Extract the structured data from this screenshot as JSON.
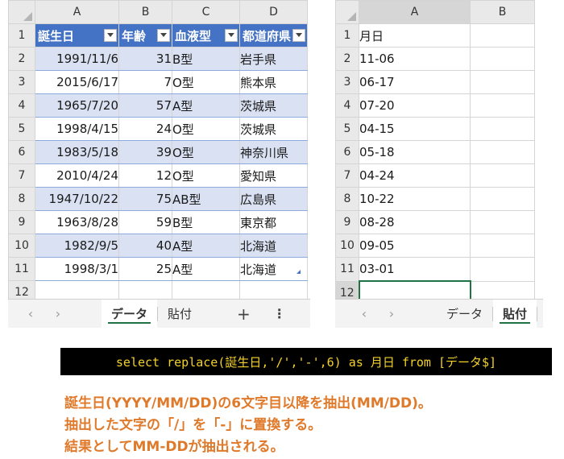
{
  "left_sheet": {
    "columns": [
      "A",
      "B",
      "C",
      "D"
    ],
    "header": [
      "誕生日",
      "年齢",
      "血液型",
      "都道府県"
    ],
    "rows": [
      {
        "n": "2",
        "date": "1991/11/6",
        "age": "31",
        "blood": "B型",
        "pref": "岩手県"
      },
      {
        "n": "3",
        "date": "2015/6/17",
        "age": "7",
        "blood": "O型",
        "pref": "熊本県"
      },
      {
        "n": "4",
        "date": "1965/7/20",
        "age": "57",
        "blood": "A型",
        "pref": "茨城県"
      },
      {
        "n": "5",
        "date": "1998/4/15",
        "age": "24",
        "blood": "O型",
        "pref": "茨城県"
      },
      {
        "n": "6",
        "date": "1983/5/18",
        "age": "39",
        "blood": "O型",
        "pref": "神奈川県"
      },
      {
        "n": "7",
        "date": "2010/4/24",
        "age": "12",
        "blood": "O型",
        "pref": "愛知県"
      },
      {
        "n": "8",
        "date": "1947/10/22",
        "age": "75",
        "blood": "AB型",
        "pref": "広島県"
      },
      {
        "n": "9",
        "date": "1963/8/28",
        "age": "59",
        "blood": "B型",
        "pref": "東京都"
      },
      {
        "n": "10",
        "date": "1982/9/5",
        "age": "40",
        "blood": "A型",
        "pref": "北海道"
      },
      {
        "n": "11",
        "date": "1998/3/1",
        "age": "25",
        "blood": "A型",
        "pref": "北海道"
      }
    ],
    "header_row_num": "1",
    "empty_row_num": "12",
    "tabs": {
      "active": "データ",
      "other": "貼付",
      "add": "+",
      "more": "⋮"
    }
  },
  "right_sheet": {
    "columns": [
      "A",
      "B"
    ],
    "rows": [
      {
        "n": "1",
        "v": "月日"
      },
      {
        "n": "2",
        "v": "11-06"
      },
      {
        "n": "3",
        "v": "06-17"
      },
      {
        "n": "4",
        "v": "07-20"
      },
      {
        "n": "5",
        "v": "04-15"
      },
      {
        "n": "6",
        "v": "05-18"
      },
      {
        "n": "7",
        "v": "04-24"
      },
      {
        "n": "8",
        "v": "10-22"
      },
      {
        "n": "9",
        "v": "08-28"
      },
      {
        "n": "10",
        "v": "09-05"
      },
      {
        "n": "11",
        "v": "03-01"
      }
    ],
    "empty_row_num": "12",
    "tabs": {
      "other": "データ",
      "active": "貼付"
    }
  },
  "sql": "select replace(誕生日,'/','-',6) as 月日 from [データ$]",
  "notes": [
    "誕生日(YYYY/MM/DD)の6文字目以降を抽出(MM/DD)。",
    "抽出した文字の「/」を「-」に置換する。",
    "結果としてMM-DDが抽出される。"
  ],
  "colors": {
    "table_header": "#4472c4",
    "band": "#d9e1f2",
    "sql_bg": "#000000",
    "sql_text": "#f4d12a",
    "note_text": "#e07a2b",
    "accent": "#217346"
  }
}
